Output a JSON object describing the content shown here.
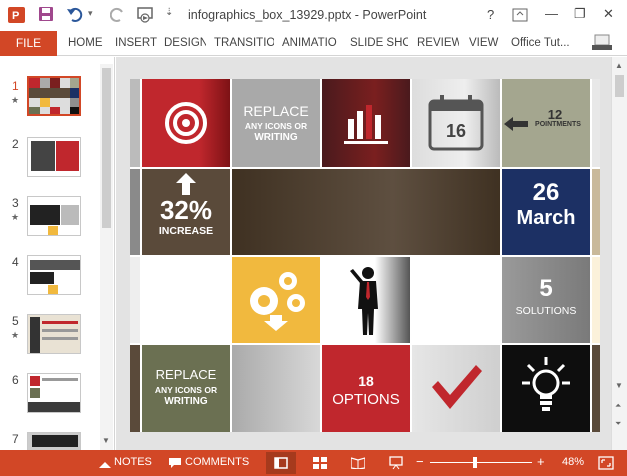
{
  "window": {
    "title": "infographics_box_13929.pptx - PowerPoint",
    "help": "?",
    "minimize": "—",
    "restore": "❐",
    "close": "✕"
  },
  "ribbon": {
    "file": "FILE",
    "tabs": [
      "HOME",
      "INSERT",
      "DESIGN",
      "TRANSITIO",
      "ANIMATIO",
      "SLIDE SHO",
      "REVIEW",
      "VIEW"
    ],
    "account": "Office Tut..."
  },
  "thumbnails": [
    {
      "num": "1",
      "star": true,
      "selected": true
    },
    {
      "num": "2",
      "star": false,
      "selected": false
    },
    {
      "num": "3",
      "star": true,
      "selected": false
    },
    {
      "num": "4",
      "star": false,
      "selected": false
    },
    {
      "num": "5",
      "star": true,
      "selected": false
    },
    {
      "num": "6",
      "star": false,
      "selected": false
    },
    {
      "num": "7",
      "star": false,
      "selected": false
    }
  ],
  "slide": {
    "calendar_day": "16",
    "replace1": {
      "line1": "REPLACE",
      "line2": "ANY ICONS OR",
      "line3": "WRITING"
    },
    "pointments": {
      "num": "12",
      "label": "POINTMENTS"
    },
    "increase": {
      "value": "32%",
      "label": "INCREASE"
    },
    "date": {
      "day": "26",
      "month": "March"
    },
    "solutions": {
      "num": "5",
      "label": "SOLUTIONS"
    },
    "replace2": {
      "line1": "REPLACE",
      "line2": "ANY ICONS OR",
      "line3": "WRITING"
    },
    "options": {
      "num": "18",
      "label": "OPTIONS"
    }
  },
  "status": {
    "notes": "NOTES",
    "comments": "COMMENTS",
    "zoom_minus": "−",
    "zoom_plus": "+",
    "zoom": "48%",
    "zoom_level": 0.48
  },
  "colors": {
    "accent": "#d24726",
    "red": "#c0272d",
    "darkred": "#7a1f1f",
    "olive": "#6b7052",
    "navy": "#1c3064",
    "yellow": "#f1b93e",
    "grey": "#8f8f8f",
    "sage": "#a4a68f",
    "brown": "#5a4a3a"
  }
}
